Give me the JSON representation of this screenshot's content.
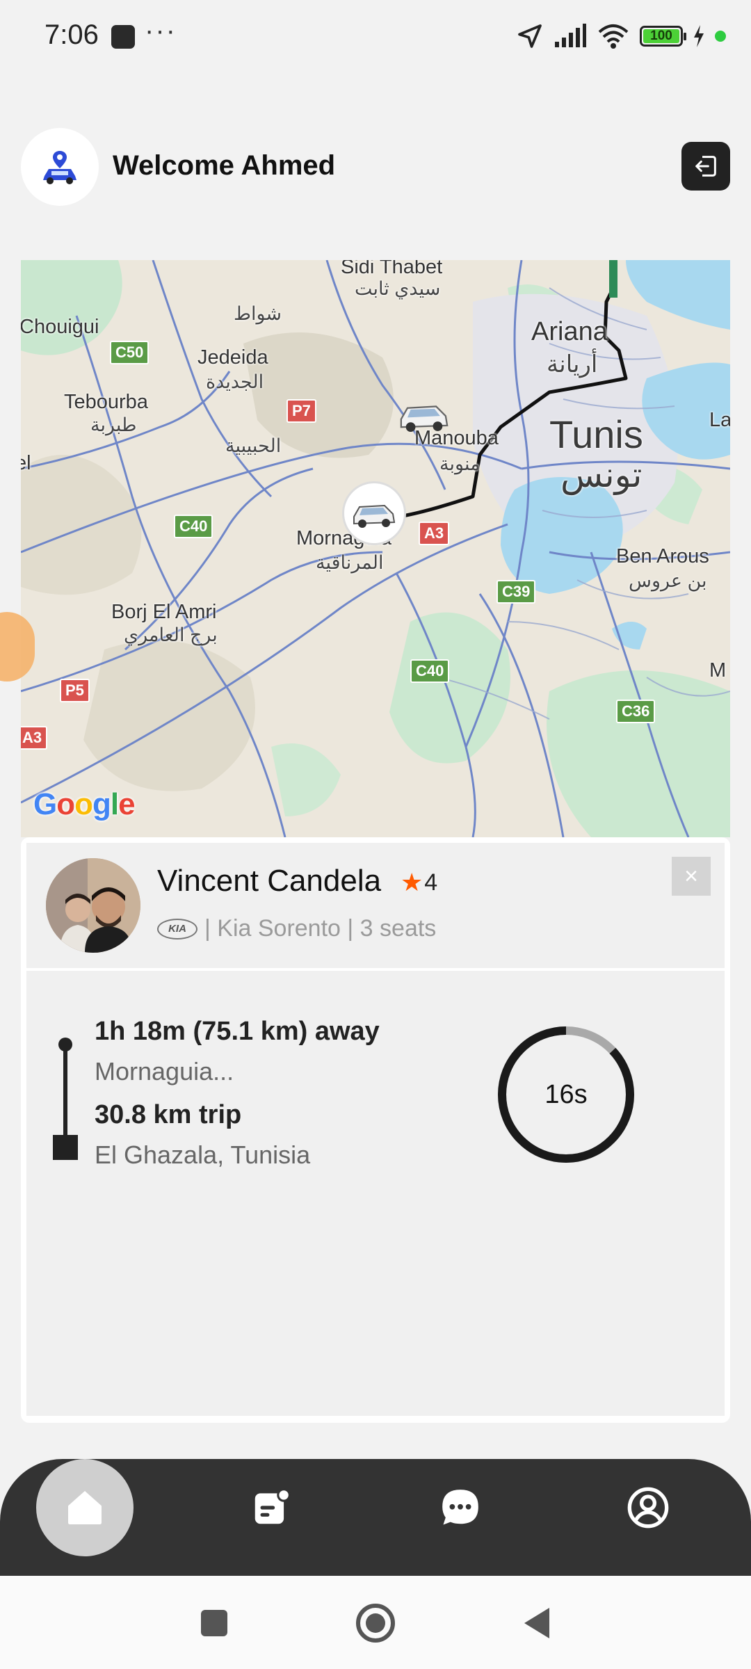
{
  "status_bar": {
    "time": "7:06",
    "dots": "···",
    "battery": "100"
  },
  "header": {
    "welcome": "Welcome Ahmed"
  },
  "map": {
    "google": "Google",
    "places": {
      "sidi_thabet": "Sidi Thabet",
      "sidi_thabet_ar": "سيدي ثابت",
      "chouigui": "Chouigui",
      "chaouat_ar": "شواط",
      "jedeida": "Jedeida",
      "jedeida_ar": "الجديدة",
      "tebourba": "Tebourba",
      "tebourba_ar": "طبربة",
      "habibia_ar": "الحبيبية",
      "ariana": "Ariana",
      "ariana_ar": "أريانة",
      "tunis": "Tunis",
      "tunis_ar": "تونس",
      "manouba": "Manouba",
      "manouba_ar": "منوبة",
      "mornaguia": "Mornaguia",
      "mornaguia_ar": "المرناقية",
      "ben_arous": "Ben Arous",
      "ben_arous_ar": "بن عروس",
      "borj_el_amri": "Borj El Amri",
      "borj_el_amri_ar": "برج العامري",
      "la": "La",
      "m": "M",
      "el": "el"
    },
    "roads": {
      "c50": "C50",
      "p7": "P7",
      "c40a": "C40",
      "a3a": "A3",
      "c39": "C39",
      "c40b": "C40",
      "c36": "C36",
      "p5": "P5",
      "a3b": "A3"
    }
  },
  "driver": {
    "name": "Vincent Candela",
    "rating": "4",
    "car_brand": "KIA",
    "car_info": "| Kia Sorento | 3 seats",
    "close": "×"
  },
  "trip": {
    "eta": "1h 18m (75.1 km) away",
    "pickup": "Mornaguia...",
    "distance": "30.8 km trip",
    "dropoff": "El Ghazala, Tunisia",
    "timer": "16s",
    "timer_progress": 0.87
  },
  "colors": {
    "accent": "#ff5a00",
    "nav_bg": "#333333",
    "battery": "#4cd137"
  },
  "icons": {
    "home": "home-icon",
    "tasks": "document-icon",
    "chat": "chat-icon",
    "profile": "profile-icon",
    "logout": "logout-icon"
  }
}
